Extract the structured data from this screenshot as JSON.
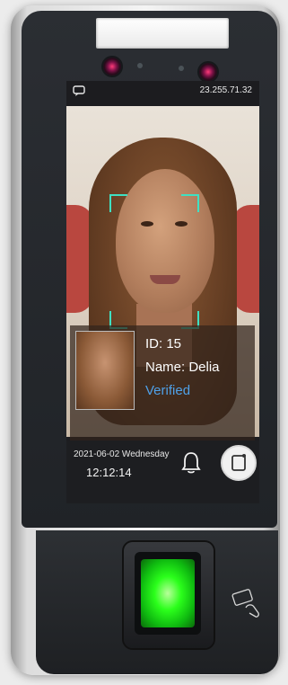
{
  "screen": {
    "ip_address": "23.255.71.32",
    "recognition": {
      "id_line": "ID: 15",
      "name_line": "Name: Delia",
      "status": "Verified"
    },
    "footer": {
      "date": "2021-06-02 Wednesday",
      "time": "12:12:14"
    }
  },
  "colors": {
    "accent_frame": "#3fe0c2",
    "verified": "#4fa1e8",
    "fingerprint_glow": "#2bff1b"
  },
  "icons": [
    "chat-icon",
    "bell-icon",
    "door-icon",
    "card-icon",
    "hand-icon"
  ]
}
